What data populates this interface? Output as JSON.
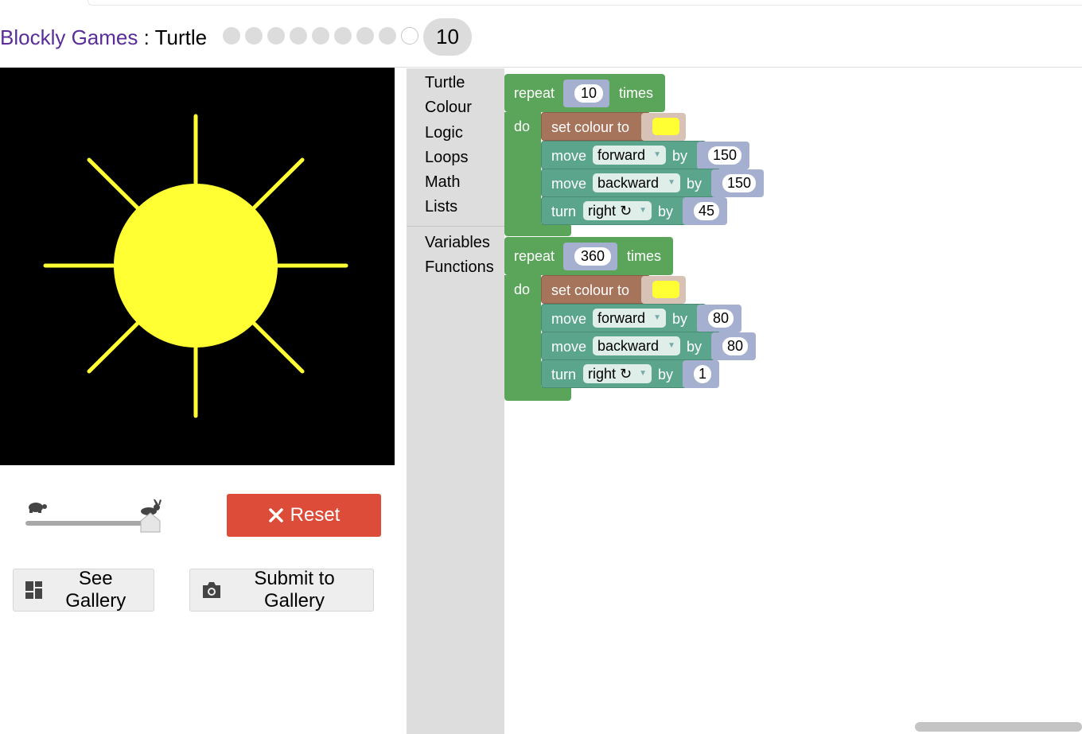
{
  "header": {
    "app_name": "Blockly Games",
    "separator": " : ",
    "game_name": "Turtle",
    "levels_total": 10,
    "levels_completed": 9,
    "current_level": "10"
  },
  "colors": {
    "loop_block": "#5ba55b",
    "colour_block": "#a5745b",
    "turtle_block": "#5ba58c",
    "drawing_colour": "#ffff33",
    "reset": "#dd4b39"
  },
  "speed_slider": {
    "value_fraction": 1.0,
    "slow_icon": "turtle-icon",
    "fast_icon": "rabbit-icon"
  },
  "buttons": {
    "reset": "Reset",
    "see_gallery": "See Gallery",
    "submit_gallery": "Submit to Gallery"
  },
  "toolbox": {
    "categories": [
      "Turtle",
      "Colour",
      "Logic",
      "Loops",
      "Math",
      "Lists"
    ],
    "categories2": [
      "Variables",
      "Functions"
    ]
  },
  "program": [
    {
      "repeat_label": "repeat",
      "count": "10",
      "times_label": "times",
      "do_label": "do",
      "set_colour_label": "set colour to",
      "colour": "#ffff33",
      "move1": {
        "label": "move",
        "dir": "forward",
        "by": "by",
        "value": "150"
      },
      "move2": {
        "label": "move",
        "dir": "backward",
        "by": "by",
        "value": "150"
      },
      "turn": {
        "label": "turn",
        "dir": "right ↻",
        "by": "by",
        "value": "45"
      }
    },
    {
      "repeat_label": "repeat",
      "count": "360",
      "times_label": "times",
      "do_label": "do",
      "set_colour_label": "set colour to",
      "colour": "#ffff33",
      "move1": {
        "label": "move",
        "dir": "forward",
        "by": "by",
        "value": "80"
      },
      "move2": {
        "label": "move",
        "dir": "backward",
        "by": "by",
        "value": "80"
      },
      "turn": {
        "label": "turn",
        "dir": "right ↻",
        "by": "by",
        "value": "1"
      }
    }
  ]
}
